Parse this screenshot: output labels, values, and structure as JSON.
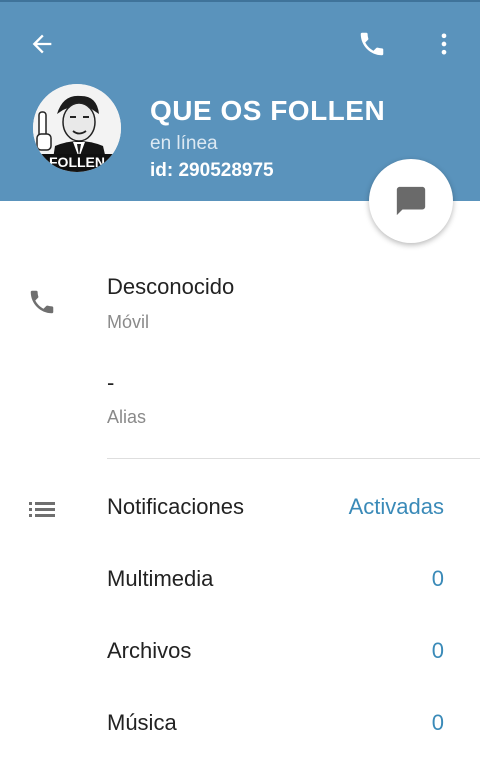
{
  "header": {
    "back_icon": "arrow-back-icon",
    "call_icon": "phone-icon",
    "more_icon": "more-vert-icon",
    "name": "QUE OS FOLLEN",
    "status": "en línea",
    "user_id": "id: 290528975",
    "avatar_text": "FOLLEN",
    "bg_color": "#5a93bc"
  },
  "fab": {
    "icon": "chat-message-icon"
  },
  "contact": {
    "phone_icon": "phone-icon",
    "phone_value": "Desconocido",
    "phone_label": "Móvil",
    "alias_value": "-",
    "alias_label": "Alias"
  },
  "settings": {
    "list_icon": "list-icon",
    "notifications_label": "Notificaciones",
    "notifications_value": "Activadas",
    "media_label": "Multimedia",
    "media_value": "0",
    "files_label": "Archivos",
    "files_value": "0",
    "music_label": "Música",
    "music_value": "0"
  },
  "colors": {
    "accent": "#3a8ab8",
    "header": "#5a93bc"
  }
}
